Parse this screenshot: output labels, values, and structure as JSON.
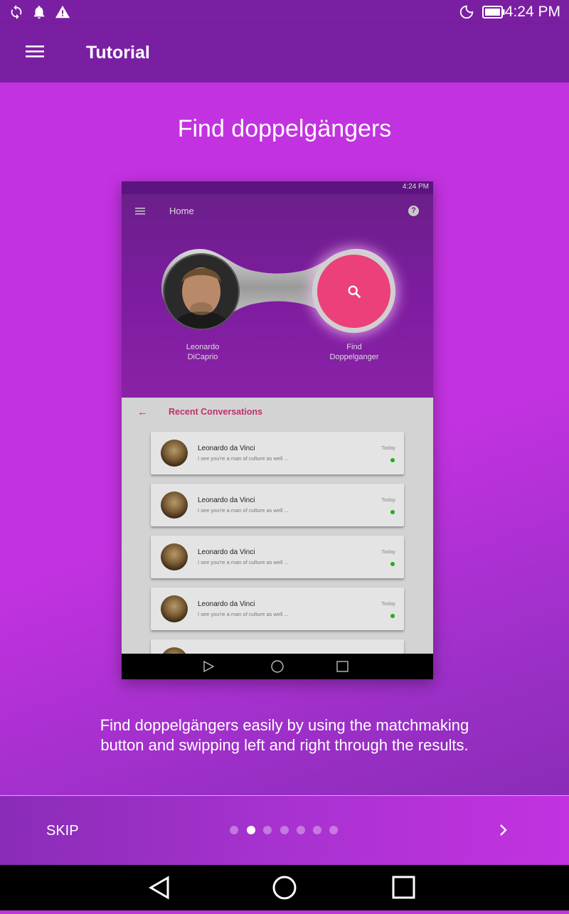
{
  "status_bar": {
    "time": "4:24 PM",
    "icons": [
      "sync-icon",
      "bell-icon",
      "warning-icon",
      "moon-icon",
      "battery-icon"
    ]
  },
  "app_bar": {
    "title": "Tutorial",
    "menu_icon": "hamburger-menu-icon"
  },
  "tutorial": {
    "heading": "Find doppelgängers",
    "description_line1": "Find doppelgängers easily by using the matchmaking",
    "description_line2": "button and swipping left and right through the results."
  },
  "mockup": {
    "status_time": "4:24 PM",
    "title": "Home",
    "help_icon": "?",
    "left_caption_1": "Leonardo",
    "left_caption_2": "DiCaprio",
    "right_caption_1": "Find",
    "right_caption_2": "Doppelganger",
    "recent_title": "Recent Conversations",
    "back_arrow": "←",
    "conversations": [
      {
        "name": "Leonardo da Vinci",
        "message": "I see you're a man of culture as well ...",
        "date": "Today"
      },
      {
        "name": "Leonardo da Vinci",
        "message": "I see you're a man of culture as well ...",
        "date": "Today"
      },
      {
        "name": "Leonardo da Vinci",
        "message": "I see you're a man of culture as well ...",
        "date": "Today"
      },
      {
        "name": "Leonardo da Vinci",
        "message": "I see you're a man of culture as well ...",
        "date": "Today"
      }
    ]
  },
  "footer": {
    "skip_label": "SKIP",
    "page_count": 7,
    "active_page": 2,
    "next_icon": "chevron-right-icon"
  },
  "colors": {
    "app_bar": "#7b1fa2",
    "background": "#c233e0",
    "accent_pink": "#ec407a"
  }
}
